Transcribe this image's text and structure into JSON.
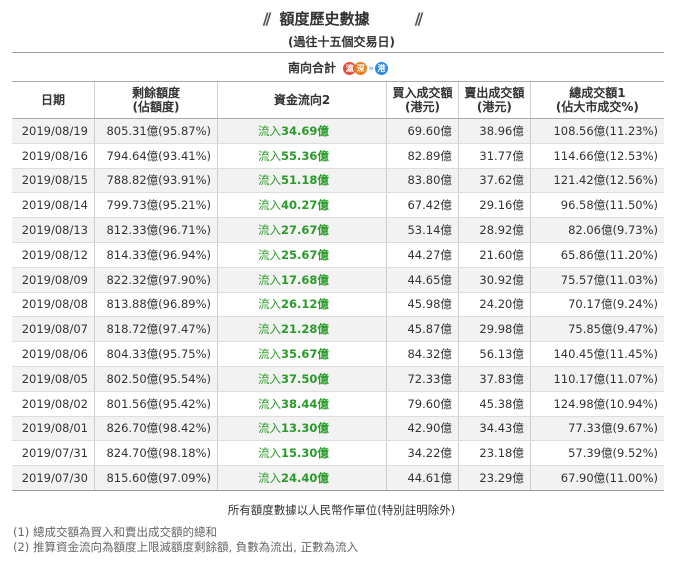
{
  "header": {
    "title": "額度歷史數據",
    "subtitle": "(過往十五個交易日)"
  },
  "table": {
    "group_label": "南向合計",
    "badges": {
      "sh": "滬",
      "sz": "深",
      "hk": "港",
      "arrow": "»"
    },
    "columns": {
      "date": "日期",
      "remaining_l1": "剩餘額度",
      "remaining_l2": "(佔額度)",
      "flow": "資金流向2",
      "buy_l1": "買入成交額",
      "buy_l2": "(港元)",
      "sell_l1": "賣出成交額",
      "sell_l2": "(港元)",
      "total_l1": "總成交額1",
      "total_l2": "(佔大市成交%)"
    },
    "rows": [
      {
        "date": "2019/08/19",
        "remaining": "805.31億(95.87%)",
        "flow_prefix": "流入",
        "flow_value": "34.69億",
        "buy": "69.60億",
        "sell": "38.96億",
        "total": "108.56億(11.23%)"
      },
      {
        "date": "2019/08/16",
        "remaining": "794.64億(93.41%)",
        "flow_prefix": "流入",
        "flow_value": "55.36億",
        "buy": "82.89億",
        "sell": "31.77億",
        "total": "114.66億(12.53%)"
      },
      {
        "date": "2019/08/15",
        "remaining": "788.82億(93.91%)",
        "flow_prefix": "流入",
        "flow_value": "51.18億",
        "buy": "83.80億",
        "sell": "37.62億",
        "total": "121.42億(12.56%)"
      },
      {
        "date": "2019/08/14",
        "remaining": "799.73億(95.21%)",
        "flow_prefix": "流入",
        "flow_value": "40.27億",
        "buy": "67.42億",
        "sell": "29.16億",
        "total": "96.58億(11.50%)"
      },
      {
        "date": "2019/08/13",
        "remaining": "812.33億(96.71%)",
        "flow_prefix": "流入",
        "flow_value": "27.67億",
        "buy": "53.14億",
        "sell": "28.92億",
        "total": "82.06億(9.73%)"
      },
      {
        "date": "2019/08/12",
        "remaining": "814.33億(96.94%)",
        "flow_prefix": "流入",
        "flow_value": "25.67億",
        "buy": "44.27億",
        "sell": "21.60億",
        "total": "65.86億(11.20%)"
      },
      {
        "date": "2019/08/09",
        "remaining": "822.32億(97.90%)",
        "flow_prefix": "流入",
        "flow_value": "17.68億",
        "buy": "44.65億",
        "sell": "30.92億",
        "total": "75.57億(11.03%)"
      },
      {
        "date": "2019/08/08",
        "remaining": "813.88億(96.89%)",
        "flow_prefix": "流入",
        "flow_value": "26.12億",
        "buy": "45.98億",
        "sell": "24.20億",
        "total": "70.17億(9.24%)"
      },
      {
        "date": "2019/08/07",
        "remaining": "818.72億(97.47%)",
        "flow_prefix": "流入",
        "flow_value": "21.28億",
        "buy": "45.87億",
        "sell": "29.98億",
        "total": "75.85億(9.47%)"
      },
      {
        "date": "2019/08/06",
        "remaining": "804.33億(95.75%)",
        "flow_prefix": "流入",
        "flow_value": "35.67億",
        "buy": "84.32億",
        "sell": "56.13億",
        "total": "140.45億(11.45%)"
      },
      {
        "date": "2019/08/05",
        "remaining": "802.50億(95.54%)",
        "flow_prefix": "流入",
        "flow_value": "37.50億",
        "buy": "72.33億",
        "sell": "37.83億",
        "total": "110.17億(11.07%)"
      },
      {
        "date": "2019/08/02",
        "remaining": "801.56億(95.42%)",
        "flow_prefix": "流入",
        "flow_value": "38.44億",
        "buy": "79.60億",
        "sell": "45.38億",
        "total": "124.98億(10.94%)"
      },
      {
        "date": "2019/08/01",
        "remaining": "826.70億(98.42%)",
        "flow_prefix": "流入",
        "flow_value": "13.30億",
        "buy": "42.90億",
        "sell": "34.43億",
        "total": "77.33億(9.67%)"
      },
      {
        "date": "2019/07/31",
        "remaining": "824.70億(98.18%)",
        "flow_prefix": "流入",
        "flow_value": "15.30億",
        "buy": "34.22億",
        "sell": "23.18億",
        "total": "57.39億(9.52%)"
      },
      {
        "date": "2019/07/30",
        "remaining": "815.60億(97.09%)",
        "flow_prefix": "流入",
        "flow_value": "24.40億",
        "buy": "44.61億",
        "sell": "23.29億",
        "total": "67.90億(11.00%)"
      }
    ]
  },
  "footer": {
    "unit_note": "所有額度數據以人民幣作單位(特別註明除外)",
    "notes": [
      "(1) 總成交額為買入和賣出成交額的總和",
      "(2) 推算資金流向為額度上限減額度剩餘額, 負數為流出, 正數為流入"
    ]
  },
  "colors": {
    "inflow": "#2a9a2a",
    "badge_sh": "#e74c3c",
    "badge_sz": "#e67e22",
    "badge_hk": "#2e86de"
  }
}
